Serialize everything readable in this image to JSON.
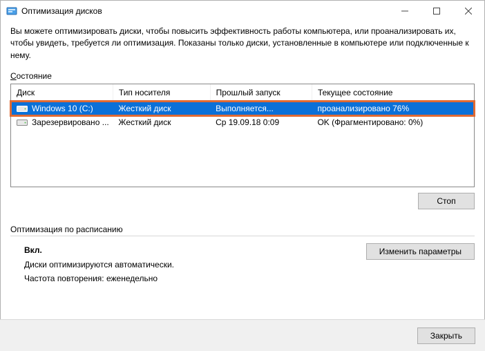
{
  "window": {
    "title": "Оптимизация дисков"
  },
  "description": "Вы можете оптимизировать диски, чтобы повысить эффективность работы  компьютера, или проанализировать их, чтобы увидеть, требуется ли оптимизация. Показаны только диски, установленные в компьютере или подключенные к нему.",
  "status_label_pre": "С",
  "status_label_post": "остояние",
  "table": {
    "headers": {
      "drive": "Диск",
      "media": "Тип носителя",
      "lastrun": "Прошлый запуск",
      "state": "Текущее состояние"
    },
    "rows": [
      {
        "drive": "Windows 10 (C:)",
        "media": "Жесткий диск",
        "lastrun": "Выполняется...",
        "state": "проанализировано 76%"
      },
      {
        "drive": "Зарезервировано ...",
        "media": "Жесткий диск",
        "lastrun": "Ср 19.09.18 0:09",
        "state": "OK (Фрагментировано: 0%)"
      }
    ]
  },
  "buttons": {
    "stop": "Стоп",
    "change_params": "Изменить параметры",
    "close": "Закрыть"
  },
  "schedule": {
    "header": "Оптимизация по расписанию",
    "state": "Вкл.",
    "line1": "Диски оптимизируются автоматически.",
    "line2": "Частота повторения: еженедельно"
  }
}
